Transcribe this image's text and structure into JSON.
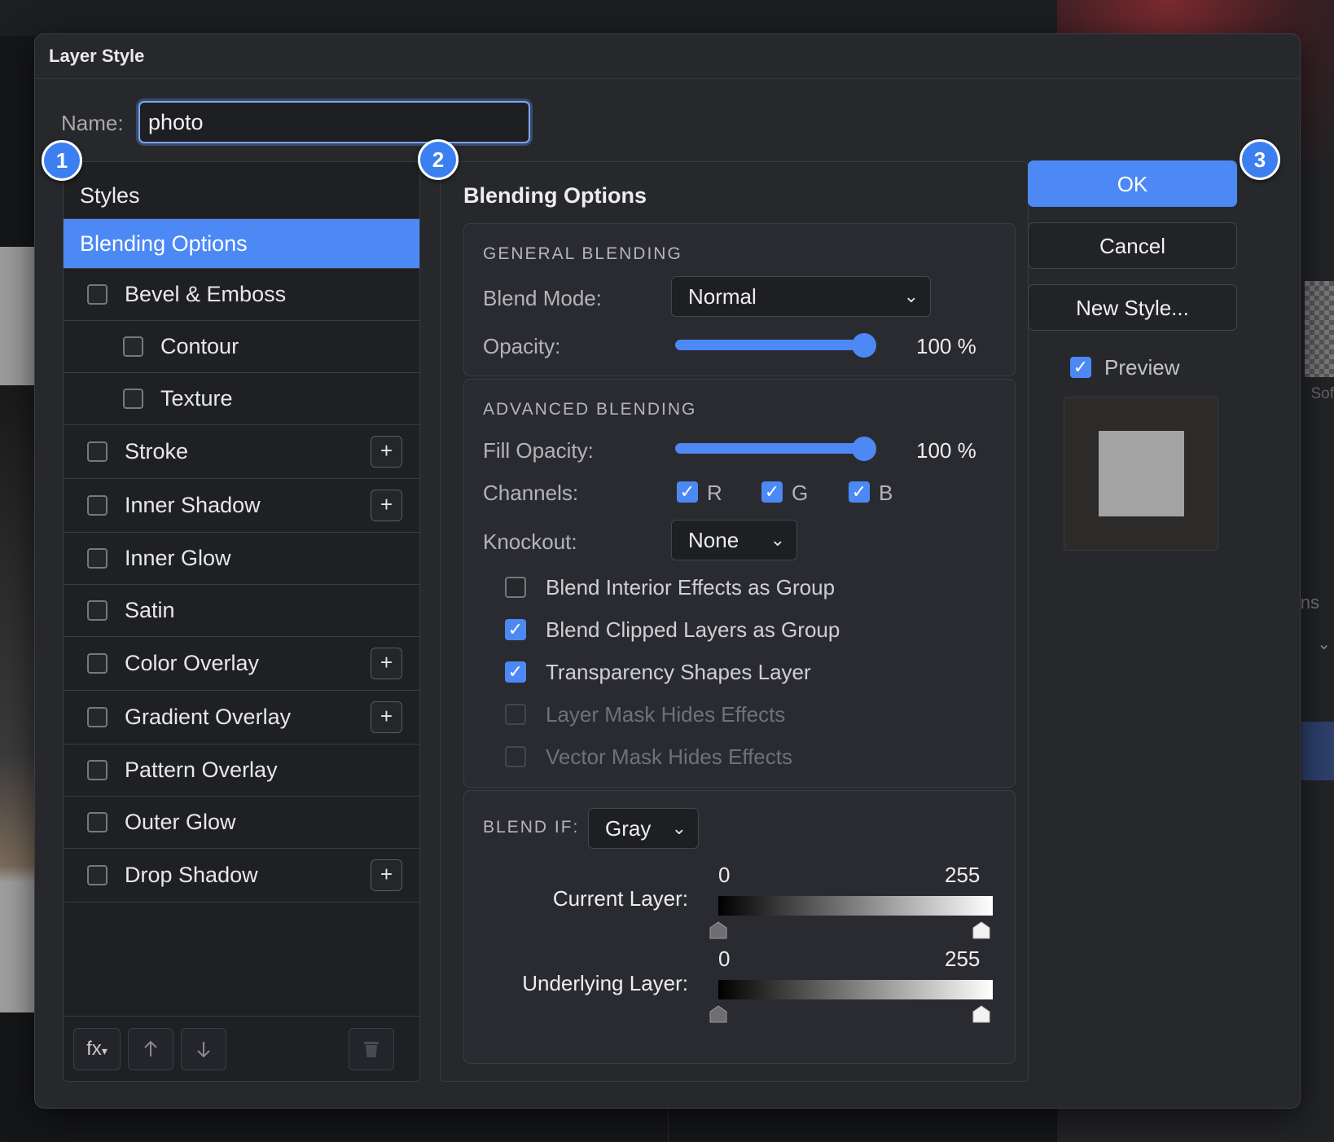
{
  "dialog": {
    "title": "Layer Style",
    "name_label": "Name:",
    "name_value": "photo"
  },
  "styles_panel": {
    "header": "Styles",
    "items": [
      {
        "label": "Blending Options",
        "active": true,
        "checkbox": false,
        "plus": false,
        "indent": false
      },
      {
        "label": "Bevel & Emboss",
        "checked": false,
        "plus": false,
        "indent": false
      },
      {
        "label": "Contour",
        "checked": false,
        "plus": false,
        "indent": true
      },
      {
        "label": "Texture",
        "checked": false,
        "plus": false,
        "indent": true
      },
      {
        "label": "Stroke",
        "checked": false,
        "plus": true,
        "indent": false
      },
      {
        "label": "Inner Shadow",
        "checked": false,
        "plus": true,
        "indent": false
      },
      {
        "label": "Inner Glow",
        "checked": false,
        "plus": false,
        "indent": false
      },
      {
        "label": "Satin",
        "checked": false,
        "plus": false,
        "indent": false
      },
      {
        "label": "Color Overlay",
        "checked": false,
        "plus": true,
        "indent": false
      },
      {
        "label": "Gradient Overlay",
        "checked": false,
        "plus": true,
        "indent": false
      },
      {
        "label": "Pattern Overlay",
        "checked": false,
        "plus": false,
        "indent": false
      },
      {
        "label": "Outer Glow",
        "checked": false,
        "plus": false,
        "indent": false
      },
      {
        "label": "Drop Shadow",
        "checked": false,
        "plus": true,
        "indent": false
      }
    ],
    "plus_symbol": "+",
    "footer": {
      "fx_label": "fx",
      "fx_caret": "▾",
      "up_icon": "arrow-up-icon",
      "down_icon": "arrow-down-icon",
      "trash_icon": "trash-icon"
    }
  },
  "blending": {
    "heading": "Blending Options",
    "general": {
      "title": "GENERAL BLENDING",
      "blend_mode_label": "Blend Mode:",
      "blend_mode_value": "Normal",
      "opacity_label": "Opacity:",
      "opacity_value": "100 %",
      "opacity_level": 1.0
    },
    "advanced": {
      "title": "ADVANCED BLENDING",
      "fill_opacity_label": "Fill Opacity:",
      "fill_opacity_value": "100 %",
      "fill_opacity_level": 1.0,
      "channels_label": "Channels:",
      "channels": [
        {
          "label": "R",
          "checked": true
        },
        {
          "label": "G",
          "checked": true
        },
        {
          "label": "B",
          "checked": true
        }
      ],
      "knockout_label": "Knockout:",
      "knockout_value": "None",
      "options": [
        {
          "label": "Blend Interior Effects as Group",
          "checked": false,
          "disabled": false
        },
        {
          "label": "Blend Clipped Layers as Group",
          "checked": true,
          "disabled": false
        },
        {
          "label": "Transparency Shapes Layer",
          "checked": true,
          "disabled": false
        },
        {
          "label": "Layer Mask Hides Effects",
          "checked": false,
          "disabled": true
        },
        {
          "label": "Vector Mask Hides Effects",
          "checked": false,
          "disabled": true
        }
      ]
    },
    "blend_if": {
      "title": "BLEND IF:",
      "channel_value": "Gray",
      "current_layer_label": "Current Layer:",
      "underlying_layer_label": "Underlying Layer:",
      "current_min": "0",
      "current_max": "255",
      "underlying_min": "0",
      "underlying_max": "255"
    }
  },
  "actions": {
    "ok": "OK",
    "cancel": "Cancel",
    "new_style": "New Style...",
    "preview_label": "Preview",
    "preview_checked": true
  },
  "badges": [
    "1",
    "2",
    "3"
  ],
  "background": {
    "right_text_1": "Sof",
    "right_text_2": "ns",
    "chevron": "⌄"
  },
  "colors": {
    "accent": "#4c89f5",
    "dialog_bg": "#27282c",
    "panel_bg": "#1f2023",
    "badge": "#3c7ff0"
  }
}
